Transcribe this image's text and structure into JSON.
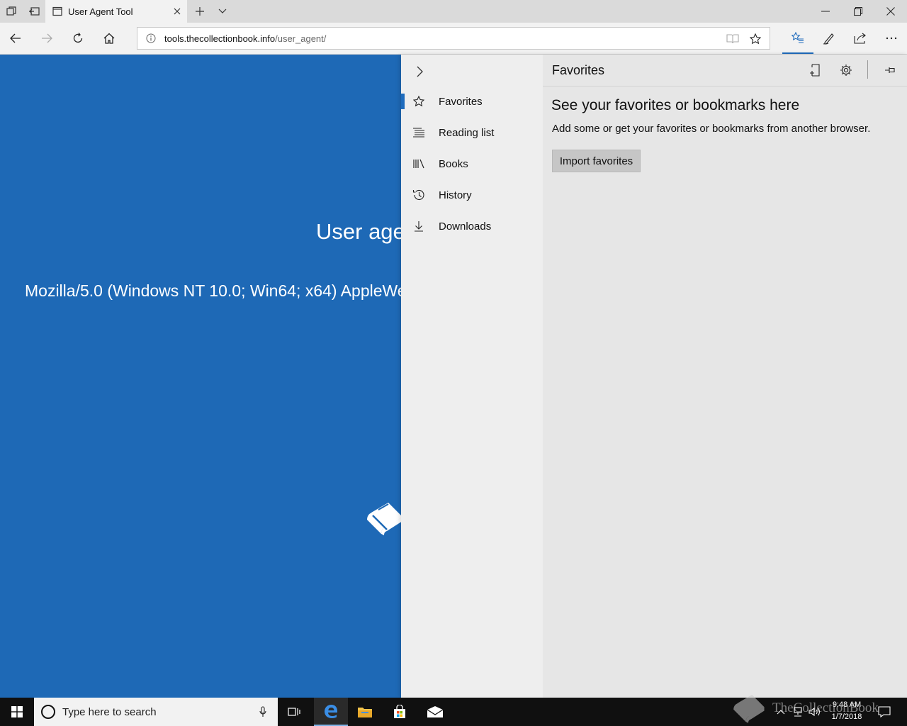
{
  "window": {
    "tab_title": "User Agent Tool"
  },
  "address": {
    "host": "tools.thecollectionbook.info",
    "path": "/user_agent/"
  },
  "page": {
    "heading": "User age",
    "user_agent": "Mozilla/5.0 (Windows NT 10.0; Win64; x64) AppleWeb"
  },
  "hub": {
    "nav_items": [
      {
        "label": "Favorites",
        "icon": "star-icon",
        "active": true
      },
      {
        "label": "Reading list",
        "icon": "reading-list-icon",
        "active": false
      },
      {
        "label": "Books",
        "icon": "books-icon",
        "active": false
      },
      {
        "label": "History",
        "icon": "history-icon",
        "active": false
      },
      {
        "label": "Downloads",
        "icon": "download-icon",
        "active": false
      }
    ],
    "title": "Favorites",
    "empty_title": "See your favorites or bookmarks here",
    "empty_desc": "Add some or get your favorites or bookmarks from another browser.",
    "import_label": "Import favorites"
  },
  "taskbar": {
    "search_placeholder": "Type here to search",
    "time": "9:48 AM",
    "date": "1/7/2018",
    "watermark": "TheCollectionBook"
  },
  "colors": {
    "page_background": "#1e69b6",
    "accent": "#1e6bbd",
    "hub_background": "#e6e6e6",
    "taskbar": "#101010"
  }
}
